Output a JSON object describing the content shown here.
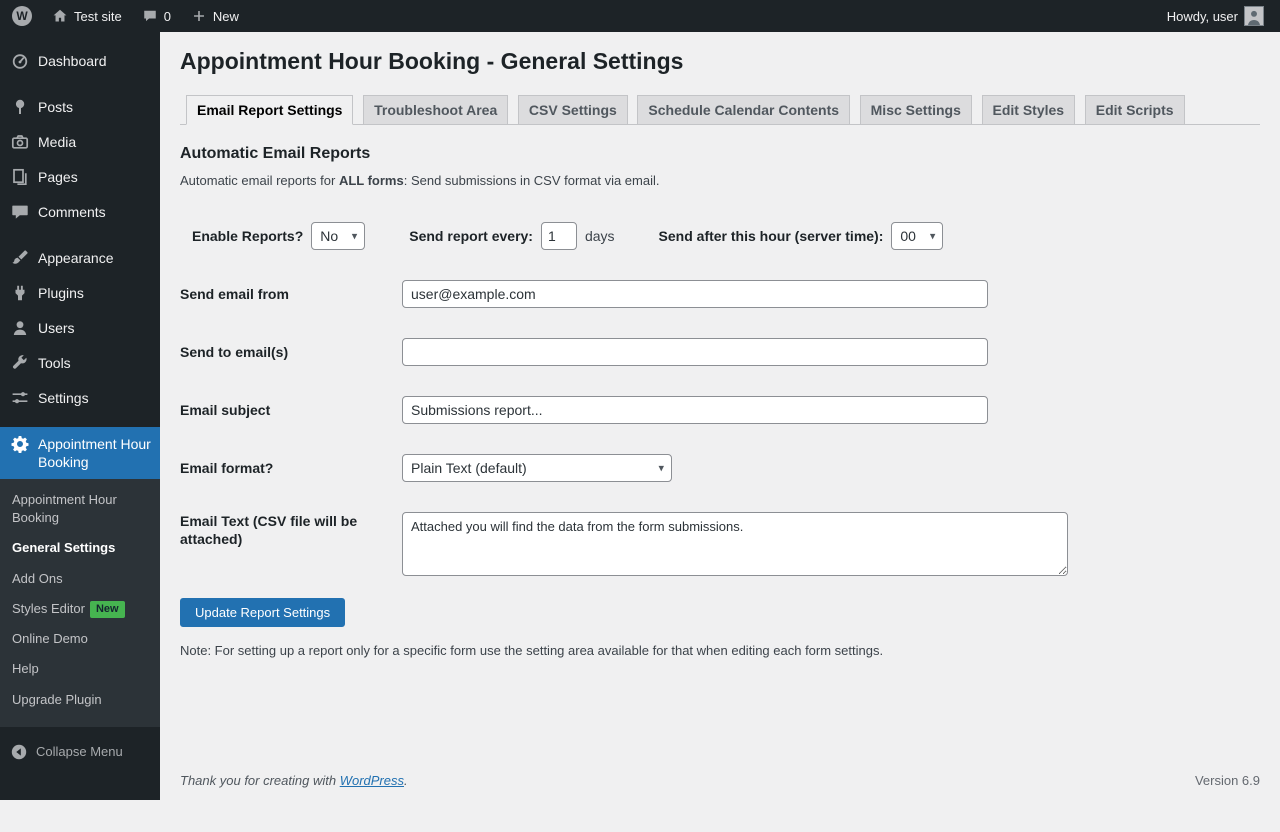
{
  "colors": {
    "accent": "#2271b1",
    "admin_bar_bg": "#1d2327",
    "content_bg": "#f0f0f1",
    "badge_new_bg": "#46b450",
    "button_bg": "#2271b1"
  },
  "admin_bar": {
    "wp_logo_letter": "W",
    "site_name": "Test site",
    "comments_count": "0",
    "new_label": "New",
    "howdy_text": "Howdy, user"
  },
  "sidebar": {
    "items": [
      "Dashboard",
      "Posts",
      "Media",
      "Pages",
      "Comments",
      "Appearance",
      "Plugins",
      "Users",
      "Tools",
      "Settings"
    ],
    "plugin_item_label": "Appointment Hour Booking",
    "submenu": [
      {
        "label": "Appointment Hour Booking"
      },
      {
        "label": "General Settings"
      },
      {
        "label": "Add Ons"
      },
      {
        "label": "Styles Editor",
        "badge": "New"
      },
      {
        "label": "Online Demo"
      },
      {
        "label": "Help"
      },
      {
        "label": "Upgrade Plugin"
      }
    ],
    "collapse_label": "Collapse Menu"
  },
  "page": {
    "title": "Appointment Hour Booking - General Settings",
    "tabs": [
      {
        "label": "Email Report Settings"
      },
      {
        "label": "Troubleshoot Area"
      },
      {
        "label": "CSV Settings"
      },
      {
        "label": "Schedule Calendar Contents"
      },
      {
        "label": "Misc Settings"
      },
      {
        "label": "Edit Styles"
      },
      {
        "label": "Edit Scripts"
      }
    ],
    "section_title": "Automatic Email Reports",
    "intro": {
      "prefix": "Automatic email reports for ",
      "bold": "ALL forms",
      "suffix": ": Send submissions in CSV format via email."
    },
    "form": {
      "enable_label": "Enable Reports?",
      "enable_value": "No",
      "every_label": "Send report every:",
      "every_value": "1",
      "every_suffix": "days",
      "hour_label": "Send after this hour (server time):",
      "hour_value": "00",
      "from_label": "Send email from",
      "from_value": "user@example.com",
      "to_label": "Send to email(s)",
      "to_value": "",
      "subject_label": "Email subject",
      "subject_value": "Submissions report...",
      "format_label": "Email format?",
      "format_value": "Plain Text (default)",
      "text_label": "Email Text (CSV file will be attached)",
      "text_value": "Attached you will find the data from the form submissions.",
      "submit_label": "Update Report Settings"
    },
    "note": "Note: For setting up a report only for a specific form use the setting area available for that when editing each form settings."
  },
  "footer": {
    "thanks_prefix": "Thank you for creating with ",
    "thanks_link": "WordPress",
    "thanks_suffix": ".",
    "version": "Version 6.9"
  }
}
